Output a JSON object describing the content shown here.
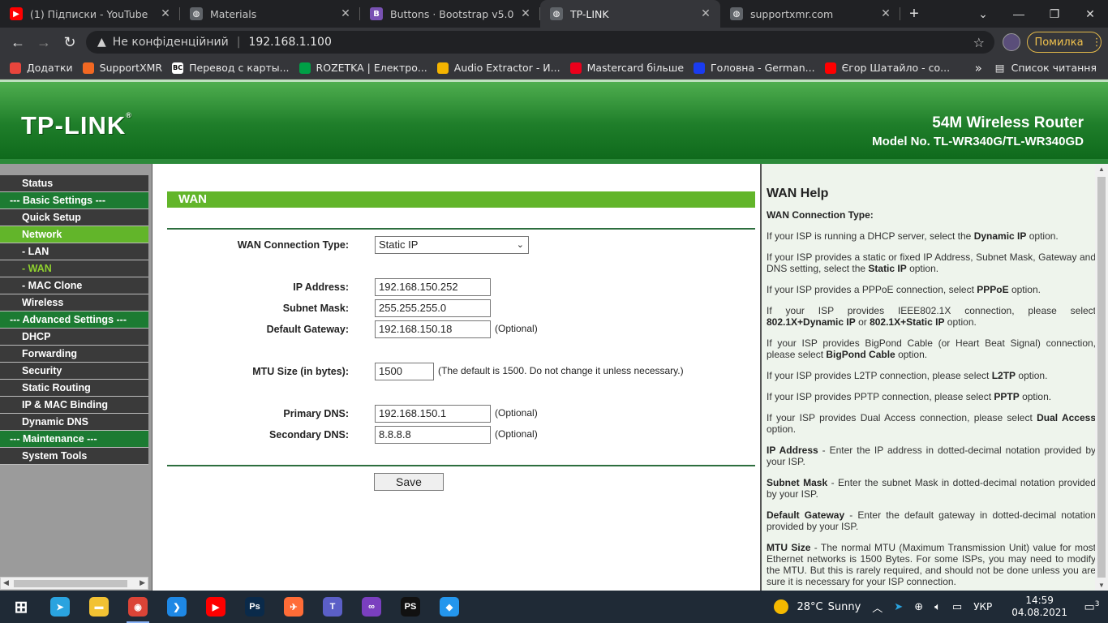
{
  "browser": {
    "tabs": [
      {
        "title": "(1) Підписки - YouTube",
        "icon": "youtube-icon",
        "color": "#ff0000",
        "glyph": "▶"
      },
      {
        "title": "Materials",
        "icon": "globe-icon",
        "color": "#5f6368",
        "glyph": "◍"
      },
      {
        "title": "Buttons · Bootstrap v5.0",
        "icon": "bootstrap-icon",
        "color": "#7952b3",
        "glyph": "B"
      },
      {
        "title": "TP-LINK",
        "icon": "globe-icon",
        "color": "#5f6368",
        "glyph": "◍",
        "active": true
      },
      {
        "title": "supportxmr.com",
        "icon": "globe-icon",
        "color": "#5f6368",
        "glyph": "◍"
      }
    ],
    "security_label": "Не конфіденційний",
    "url": "192.168.1.100",
    "error_button": "Помилка",
    "bookmarks": [
      {
        "label": "Додатки",
        "icon": "apps-grid-icon",
        "color": "#e8453c"
      },
      {
        "label": "SupportXMR",
        "icon": "supportxmr-icon",
        "color": "#f26822"
      },
      {
        "label": "Перевод с карты...",
        "icon": "bc-icon",
        "color": "#ffffff"
      },
      {
        "label": "ROZETKA | Електро...",
        "icon": "rozetka-icon",
        "color": "#00a046"
      },
      {
        "label": "Audio Extractor - И...",
        "icon": "audio-extractor-icon",
        "color": "#f4b400"
      },
      {
        "label": "Mastercard більше",
        "icon": "mastercard-icon",
        "color": "#eb001b"
      },
      {
        "label": "Головна - German...",
        "icon": "german-icon",
        "color": "#1a3cf0"
      },
      {
        "label": "Єгор Шатайло - со...",
        "icon": "youtube-icon",
        "color": "#ff0000"
      }
    ],
    "more_label": "»",
    "reading_list": "Список читання"
  },
  "router": {
    "logo": "TP-LINK",
    "product_name": "54M Wireless Router",
    "model": "Model No. TL-WR340G/TL-WR340GD"
  },
  "menu": [
    {
      "label": "Status",
      "kind": "item"
    },
    {
      "label": "--- Basic Settings ---",
      "kind": "hdr"
    },
    {
      "label": "Quick Setup",
      "kind": "item"
    },
    {
      "label": "Network",
      "kind": "act"
    },
    {
      "label": "- LAN",
      "kind": "item"
    },
    {
      "label": "- WAN",
      "kind": "cur"
    },
    {
      "label": "- MAC Clone",
      "kind": "item"
    },
    {
      "label": "Wireless",
      "kind": "item"
    },
    {
      "label": "--- Advanced Settings ---",
      "kind": "hdr"
    },
    {
      "label": "DHCP",
      "kind": "item"
    },
    {
      "label": "Forwarding",
      "kind": "item"
    },
    {
      "label": "Security",
      "kind": "item"
    },
    {
      "label": "Static Routing",
      "kind": "item"
    },
    {
      "label": "IP & MAC Binding",
      "kind": "item"
    },
    {
      "label": "Dynamic DNS",
      "kind": "item"
    },
    {
      "label": "--- Maintenance ---",
      "kind": "hdr"
    },
    {
      "label": "System Tools",
      "kind": "item"
    }
  ],
  "wan": {
    "title": "WAN",
    "connection_type_label": "WAN Connection Type:",
    "connection_type_value": "Static IP",
    "ip_label": "IP Address:",
    "ip_value": "192.168.150.252",
    "mask_label": "Subnet Mask:",
    "mask_value": "255.255.255.0",
    "gateway_label": "Default Gateway:",
    "gateway_value": "192.168.150.18",
    "optional": "(Optional)",
    "mtu_label": "MTU Size (in bytes):",
    "mtu_value": "1500",
    "mtu_note": "(The default is 1500. Do not change it unless necessary.)",
    "dns1_label": "Primary DNS:",
    "dns1_value": "192.168.150.1",
    "dns2_label": "Secondary DNS:",
    "dns2_value": "8.8.8.8",
    "save": "Save"
  },
  "help": {
    "title": "WAN Help",
    "subtitle": "WAN Connection Type:",
    "paragraphs": [
      "If your ISP is running a DHCP server, select the <b>Dynamic IP</b> option.",
      "If your ISP provides a static or fixed IP Address, Subnet Mask, Gateway and DNS setting, select the <b>Static IP</b> option.",
      "If your ISP provides a PPPoE connection, select <b>PPPoE</b> option.",
      "If your ISP provides IEEE802.1X connection, please select <b>802.1X+Dynamic IP</b> or <b>802.1X+Static IP</b> option.",
      "If your ISP provides BigPond Cable (or Heart Beat Signal) connection, please select <b>BigPond Cable</b> option.",
      "If your ISP provides L2TP connection, please select <b>L2TP</b> option.",
      "If your ISP provides PPTP connection, please select <b>PPTP</b> option.",
      "If your ISP provides Dual Access connection, please select <b>Dual Access</b> option.",
      "<b>IP Address</b> - Enter the IP address in dotted-decimal notation provided by your ISP.",
      "<b>Subnet Mask</b> - Enter the subnet Mask in dotted-decimal notation provided by your ISP.",
      "<b>Default Gateway</b> - Enter the default gateway in dotted-decimal notation provided by your ISP.",
      "<b>MTU Size</b> - The normal MTU (Maximum Transmission Unit) value for most Ethernet networks is 1500 Bytes. For some ISPs, you may need to modify the MTU. But this is rarely required, and should not be done unless you are sure it is necessary for your ISP connection."
    ]
  },
  "taskbar": {
    "apps": [
      {
        "name": "start-button",
        "glyph": "⊞",
        "color": "transparent"
      },
      {
        "name": "telegram-icon",
        "glyph": "➤",
        "color": "#2aa3df"
      },
      {
        "name": "file-explorer-icon",
        "glyph": "▬",
        "color": "#f2c233"
      },
      {
        "name": "chrome-icon",
        "glyph": "◉",
        "color": "#db4437",
        "running": true
      },
      {
        "name": "vscode-icon",
        "glyph": "❯",
        "color": "#1e88e5"
      },
      {
        "name": "youtube-icon",
        "glyph": "▶",
        "color": "#ff0000"
      },
      {
        "name": "photoshop-icon",
        "glyph": "Ps",
        "color": "#0a2a4a"
      },
      {
        "name": "postman-icon",
        "glyph": "✈",
        "color": "#ff6c37"
      },
      {
        "name": "teams-icon",
        "glyph": "T",
        "color": "#5b5fc7"
      },
      {
        "name": "visual-studio-icon",
        "glyph": "∞",
        "color": "#7a3fbf"
      },
      {
        "name": "phpstorm-icon",
        "glyph": "PS",
        "color": "#111111"
      },
      {
        "name": "docker-icon",
        "glyph": "◆",
        "color": "#2496ed"
      }
    ],
    "weather_temp": "28°C",
    "weather_desc": "Sunny",
    "lang": "УКР",
    "time": "14:59",
    "date": "04.08.2021",
    "notifications": "3"
  }
}
